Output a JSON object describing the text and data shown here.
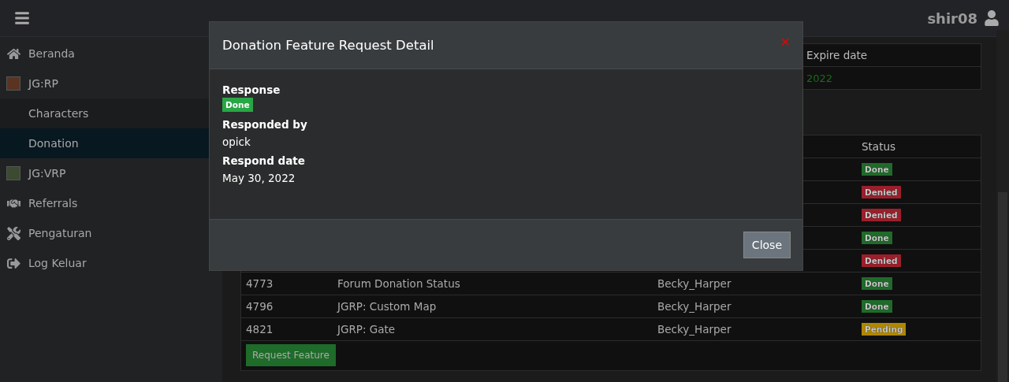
{
  "topbar": {
    "username": "shir08"
  },
  "sidebar": {
    "items": [
      {
        "label": "Beranda",
        "selected": false
      },
      {
        "label": "JG:RP",
        "selected": false,
        "children": [
          {
            "label": "Characters",
            "selected": false
          },
          {
            "label": "Donation",
            "selected": true
          }
        ]
      },
      {
        "label": "JG:VRP",
        "selected": false
      },
      {
        "label": "Referrals",
        "selected": false
      },
      {
        "label": "Pengaturan",
        "selected": false
      },
      {
        "label": "Log Keluar",
        "selected": false
      }
    ]
  },
  "subscription_table": {
    "columns": [
      "Expire date"
    ],
    "rows": [
      {
        "expire_date": "2022"
      }
    ]
  },
  "requests_table": {
    "columns": [
      {
        "label": "Status"
      }
    ],
    "rows": [
      {
        "status": "Done",
        "color": "#1f6b2a"
      },
      {
        "status": "Denied",
        "color": "#9b1f2b"
      },
      {
        "status": "Denied",
        "color": "#9b1f2b"
      },
      {
        "status": "Done",
        "color": "#1f6b2a"
      },
      {
        "status": "Denied",
        "color": "#9b1f2b"
      },
      {
        "id": "4773",
        "service": "Forum Donation Status",
        "account": "Becky_Harper",
        "status": "Done",
        "color": "#1f6b2a"
      },
      {
        "id": "4796",
        "service": "JGRP: Custom Map",
        "account": "Becky_Harper",
        "status": "Done",
        "color": "#1f6b2a"
      },
      {
        "id": "4821",
        "service": "JGRP: Gate",
        "account": "Becky_Harper",
        "status": "Pending",
        "color": "#b08800"
      }
    ],
    "request_button": "Request Feature"
  },
  "modal": {
    "title": "Donation Feature Request Detail",
    "close_icon": "×",
    "fields": [
      {
        "label": "Response",
        "value": "Done",
        "kind": "badge",
        "color": "#28a745"
      },
      {
        "label": "Responded by",
        "value": "opick",
        "kind": "text"
      },
      {
        "label": "Respond date",
        "value": "May 30, 2022",
        "kind": "text"
      }
    ],
    "close_button": "Close"
  }
}
